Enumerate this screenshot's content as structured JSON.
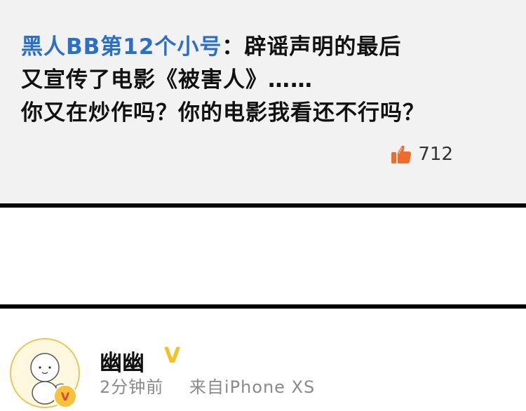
{
  "comment": {
    "username": "黑人BB第12个小号",
    "separator": "：",
    "line1_text": "辟谣声明的最后",
    "line2_text": "又宣传了电影《被害人》……",
    "line3_text": "你又在炒作吗？你的电影我看还不行吗？",
    "like_icon": "thumbs-up-icon",
    "like_count": "712"
  },
  "post": {
    "avatar_icon": "cartoon-avatar",
    "vip_badge": "V",
    "username": "幽幽",
    "verified_mark": "V",
    "time": "2分钟前",
    "source": "来自iPhone XS"
  },
  "colors": {
    "username_blue": "#2a6fc9",
    "like_orange": "#f06a2a",
    "verified_yellow": "#f4c322",
    "meta_gray": "#8a8a8a"
  }
}
